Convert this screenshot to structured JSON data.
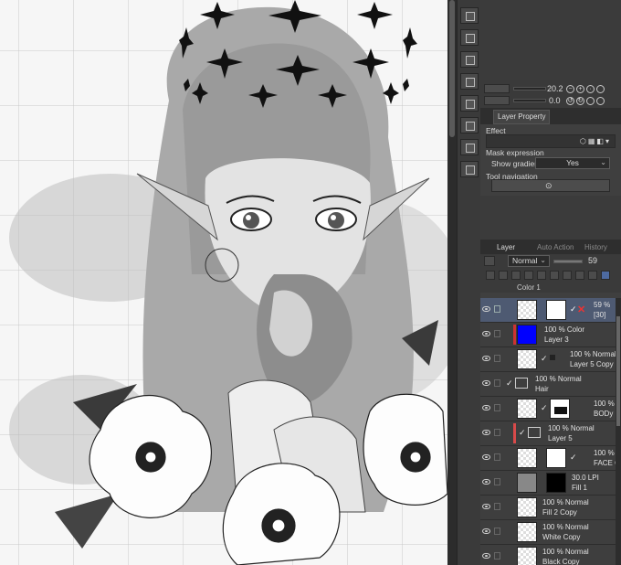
{
  "brush": {
    "size": "20.2",
    "opacity": "0.0"
  },
  "panel_tabs": {
    "layer_property": "Layer Property"
  },
  "layer_property": {
    "effect_label": "Effect",
    "mask_expression_label": "Mask expression",
    "show_gradients_label": "Show gradients",
    "show_gradients_value": "Yes",
    "tool_navigation_label": "Tool navigation"
  },
  "layer_tabs": {
    "layer": "Layer",
    "auto_action": "Auto Action",
    "history": "History"
  },
  "layer_controls": {
    "blend_mode": "Normal",
    "opacity_value": "59"
  },
  "layers": [
    {
      "mode": "",
      "name": "Color 1"
    },
    {
      "mode": "59 %",
      "name": "[30]"
    },
    {
      "mode": "100 % Color",
      "name": "Layer 3"
    },
    {
      "mode": "100 % Normal",
      "name": "Layer 5 Copy"
    },
    {
      "mode": "100 % Normal",
      "name": "Hair"
    },
    {
      "mode": "100 %",
      "name": "BODy"
    },
    {
      "mode": "100 % Normal",
      "name": "Layer 5"
    },
    {
      "mode": "100 %",
      "name": "FACE C"
    },
    {
      "mode": "30.0 LPI",
      "name": "Fill 1"
    },
    {
      "mode": "100 % Normal",
      "name": "Fill 2 Copy"
    },
    {
      "mode": "100 % Normal",
      "name": "White Copy"
    },
    {
      "mode": "100 % Normal",
      "name": "Black Copy"
    }
  ],
  "colors": {
    "panel": "#3f3f3f",
    "selected_layer": "#4e5a72",
    "fill_blue": "#0000ff",
    "accent_red": "#d84a4a"
  },
  "icons": [
    "eye-icon",
    "lock-icon",
    "mask-icon",
    "close-icon",
    "gear-icon",
    "toolbar-icons"
  ]
}
